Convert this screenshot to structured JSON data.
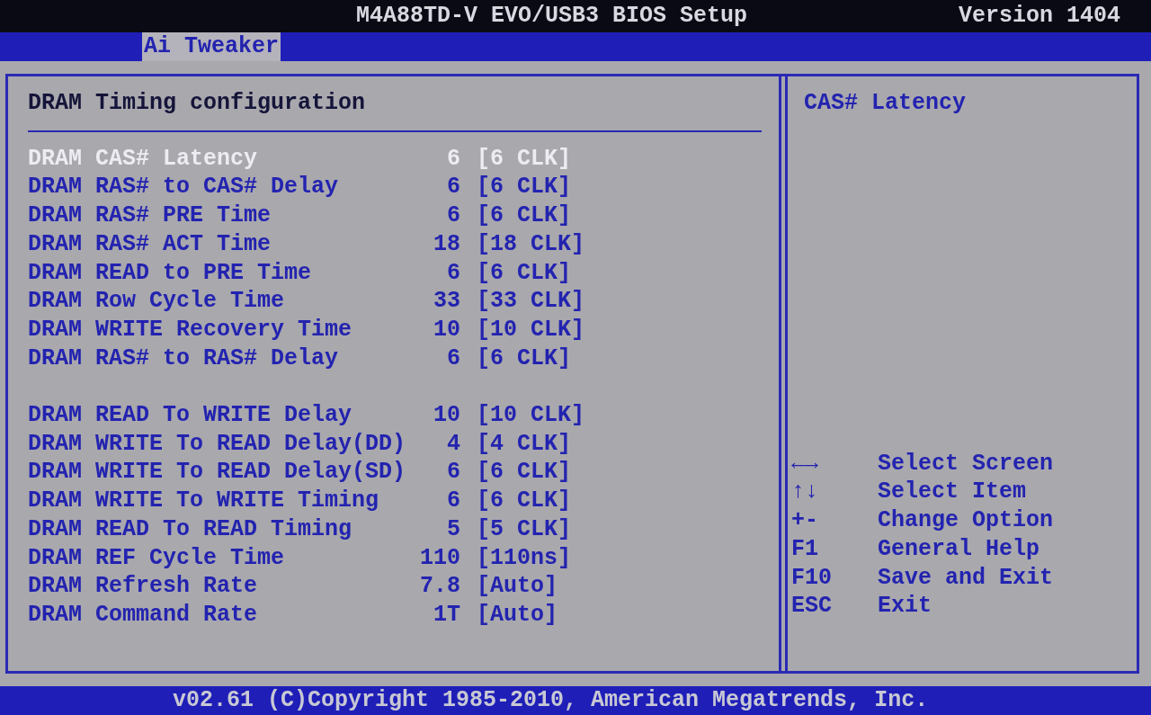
{
  "title_bar": {
    "title": "M4A88TD-V EVO/USB3 BIOS Setup",
    "version": "Version 1404"
  },
  "tabs": [
    {
      "label": "Ai Tweaker",
      "selected": true
    }
  ],
  "panel": {
    "heading": "DRAM Timing configuration",
    "groups": [
      [
        {
          "label": "DRAM CAS# Latency",
          "value": "6",
          "setting": "[6 CLK]",
          "selected": true
        },
        {
          "label": "DRAM RAS# to CAS# Delay",
          "value": "6",
          "setting": "[6 CLK]",
          "selected": false
        },
        {
          "label": "DRAM RAS# PRE Time",
          "value": "6",
          "setting": "[6 CLK]",
          "selected": false
        },
        {
          "label": "DRAM RAS# ACT Time",
          "value": "18",
          "setting": "[18 CLK]",
          "selected": false
        },
        {
          "label": "DRAM READ to PRE Time",
          "value": "6",
          "setting": "[6 CLK]",
          "selected": false
        },
        {
          "label": "DRAM Row Cycle Time",
          "value": "33",
          "setting": "[33 CLK]",
          "selected": false
        },
        {
          "label": "DRAM WRITE Recovery Time",
          "value": "10",
          "setting": "[10 CLK]",
          "selected": false
        },
        {
          "label": "DRAM RAS# to RAS# Delay",
          "value": "6",
          "setting": "[6 CLK]",
          "selected": false
        }
      ],
      [
        {
          "label": "DRAM READ To WRITE Delay",
          "value": "10",
          "setting": "[10 CLK]",
          "selected": false
        },
        {
          "label": "DRAM WRITE To READ Delay(DD)",
          "value": "4",
          "setting": "[4 CLK]",
          "selected": false
        },
        {
          "label": "DRAM WRITE To READ Delay(SD)",
          "value": "6",
          "setting": "[6 CLK]",
          "selected": false
        },
        {
          "label": "DRAM WRITE To WRITE Timing",
          "value": "6",
          "setting": "[6 CLK]",
          "selected": false
        },
        {
          "label": "DRAM READ To READ Timing",
          "value": "5",
          "setting": "[5 CLK]",
          "selected": false
        },
        {
          "label": "DRAM REF Cycle Time",
          "value": "110",
          "setting": "[110ns]",
          "selected": false
        },
        {
          "label": "DRAM Refresh Rate",
          "value": "7.8",
          "setting": "[Auto]",
          "selected": false
        },
        {
          "label": "DRAM Command Rate",
          "value": "1T",
          "setting": "[Auto]",
          "selected": false
        }
      ]
    ]
  },
  "help": {
    "text": "CAS# Latency",
    "keys": [
      {
        "key": "←→",
        "action": "Select Screen"
      },
      {
        "key": "↑↓",
        "action": "Select Item"
      },
      {
        "key": "+-",
        "action": "Change Option"
      },
      {
        "key": "F1",
        "action": "General Help"
      },
      {
        "key": "F10",
        "action": "Save and Exit"
      },
      {
        "key": "ESC",
        "action": "Exit"
      }
    ]
  },
  "footer": "v02.61 (C)Copyright 1985-2010, American Megatrends, Inc."
}
